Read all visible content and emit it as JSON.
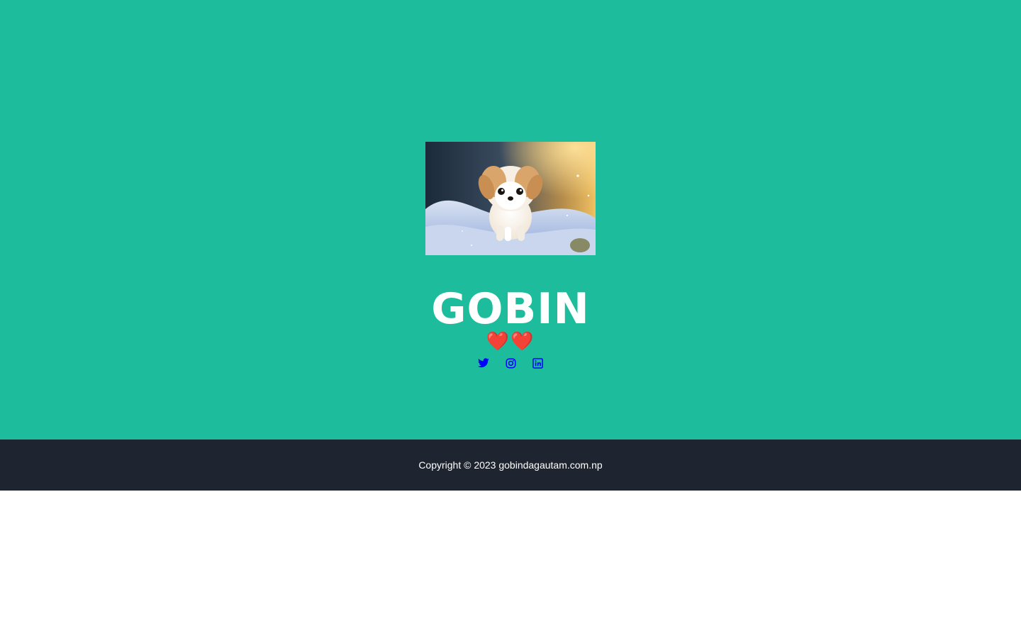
{
  "profile": {
    "name": "GOBIN",
    "hearts": "❤️❤️",
    "photo_subject": "fluffy puppy in snow"
  },
  "socials": [
    {
      "icon": "twitter-icon",
      "color": "#0000ff"
    },
    {
      "icon": "instagram-icon",
      "color": "#0000ff"
    },
    {
      "icon": "linkedin-icon",
      "color": "#0000ff"
    }
  ],
  "footer": {
    "copyright": "Copyright © 2023 gobindagautam.com.np"
  },
  "colors": {
    "hero_background": "#1dbc9c",
    "footer_background": "#1f2530",
    "page_background": "#ffffff",
    "text": "#ffffff",
    "icon": "#0000ff"
  }
}
